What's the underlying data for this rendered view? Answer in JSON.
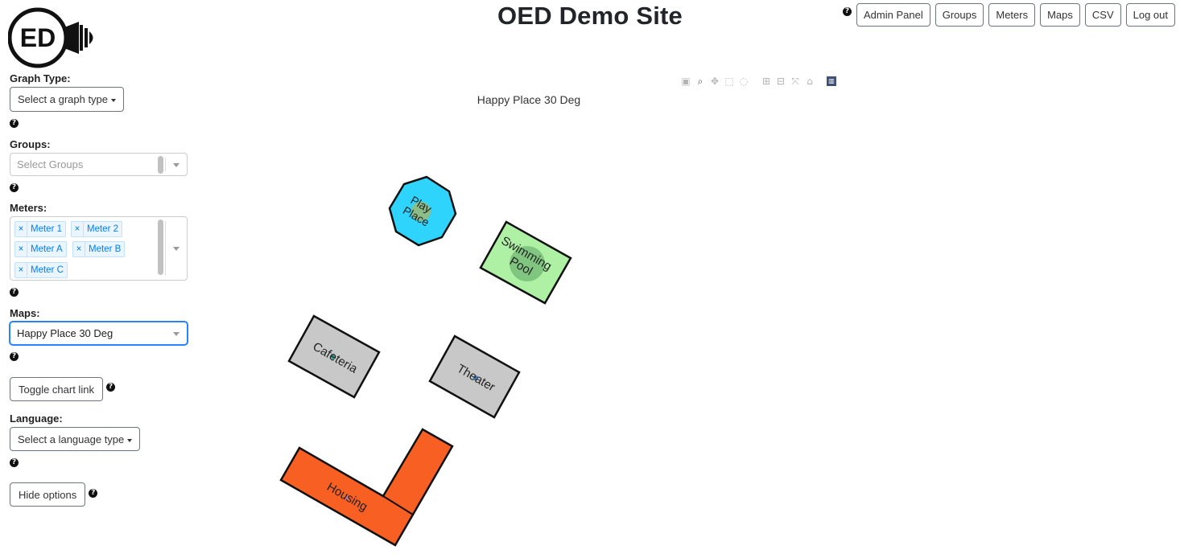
{
  "header": {
    "logo_text": "ED",
    "site_title": "OED Demo Site",
    "nav": {
      "admin_panel": "Admin Panel",
      "groups": "Groups",
      "meters": "Meters",
      "maps": "Maps",
      "csv": "CSV",
      "log_out": "Log out"
    }
  },
  "sidebar": {
    "graph_type": {
      "label": "Graph Type:",
      "value": "Select a graph type"
    },
    "groups": {
      "label": "Groups:",
      "placeholder": "Select Groups"
    },
    "meters": {
      "label": "Meters:",
      "selected": [
        "Meter 1",
        "Meter 2",
        "Meter A",
        "Meter B",
        "Meter C"
      ]
    },
    "maps": {
      "label": "Maps:",
      "value": "Happy Place 30 Deg"
    },
    "toggle_chart_link": "Toggle chart link",
    "language": {
      "label": "Language:",
      "value": "Select a language type"
    },
    "hide_options": "Hide options",
    "help_glyph": "?"
  },
  "chart": {
    "title": "Happy Place 30 Deg",
    "modebar_icons": [
      "camera-icon",
      "zoom-icon",
      "pan-icon",
      "box-select-icon",
      "lasso-select-icon",
      "zoom-in-icon",
      "zoom-out-icon",
      "autoscale-icon",
      "reset-axes-icon",
      "plotly-logo-icon"
    ],
    "buildings": [
      {
        "name": "Play Place",
        "label_lines": [
          "Play",
          "Place"
        ],
        "fill": "#2fd4fd"
      },
      {
        "name": "Swimming Pool",
        "label_lines": [
          "Swimming",
          "Pool"
        ],
        "fill": "#aef0a4"
      },
      {
        "name": "Cafeteria",
        "label_lines": [
          "Cafeteria"
        ],
        "fill": "#c8c8c8"
      },
      {
        "name": "Theater",
        "label_lines": [
          "Theater"
        ],
        "fill": "#c8c8c8"
      },
      {
        "name": "Housing",
        "label_lines": [
          "Housing"
        ],
        "fill": "#f85f22"
      }
    ]
  }
}
